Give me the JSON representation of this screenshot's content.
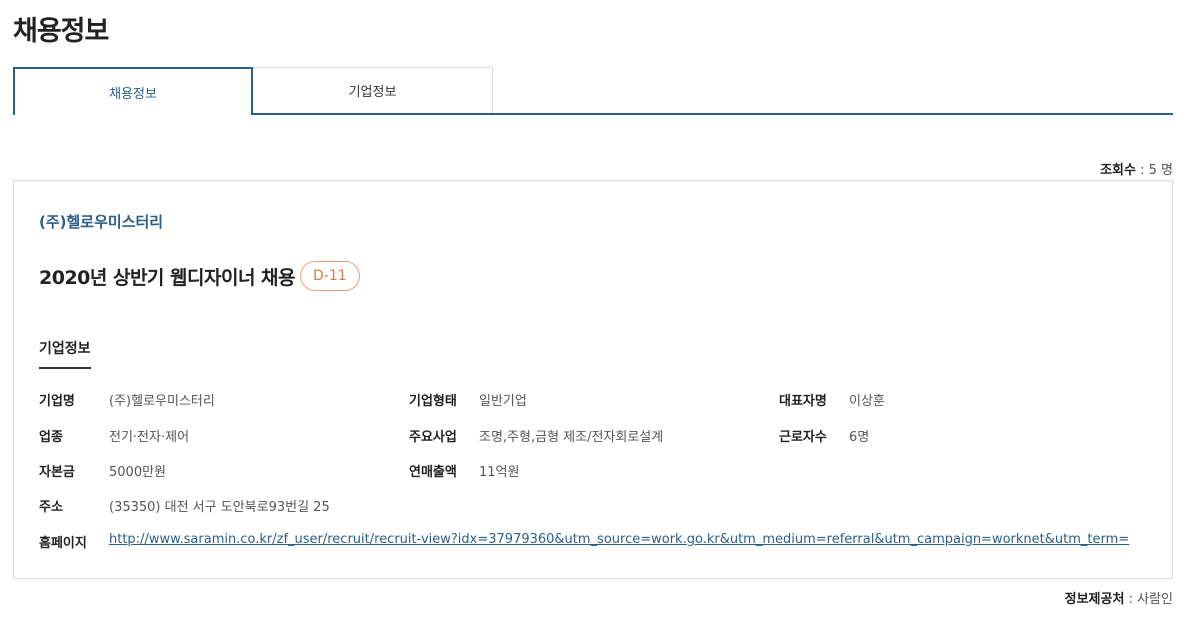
{
  "page_title": "채용정보",
  "tabs": [
    {
      "label": "채용정보",
      "active": true
    },
    {
      "label": "기업정보",
      "active": false
    }
  ],
  "views": {
    "label": "조회수",
    "separator": " : ",
    "value": "5 명"
  },
  "company_name": "(주)헬로우미스터리",
  "job_title": "2020년 상반기 웹디자이너 채용",
  "dday": "D-11",
  "section_title": "기업정보",
  "info": {
    "company_label": "기업명",
    "company_value": "(주)헬로우미스터리",
    "type_label": "기업형태",
    "type_value": "일반기업",
    "ceo_label": "대표자명",
    "ceo_value": "이상훈",
    "industry_label": "업종",
    "industry_value": "전기·전자·제어",
    "business_label": "주요사업",
    "business_value": "조명,주형,금형 제조/전자회로설계",
    "employees_label": "근로자수",
    "employees_value": "6명",
    "capital_label": "자본금",
    "capital_value": "5000만원",
    "sales_label": "연매출액",
    "sales_value": "11억원",
    "address_label": "주소",
    "address_value": "(35350) 대전 서구 도안북로93번길 25",
    "homepage_label": "홈페이지",
    "homepage_value": "http://www.saramin.co.kr/zf_user/recruit/recruit-view?idx=37979360&utm_source=work.go.kr&utm_medium=referral&utm_campaign=worknet&utm_term="
  },
  "source": {
    "label": "정보제공처",
    "separator": " : ",
    "value": "사람인"
  },
  "colors": {
    "accent": "#2b5f8a",
    "dday": "#d97a4a"
  }
}
